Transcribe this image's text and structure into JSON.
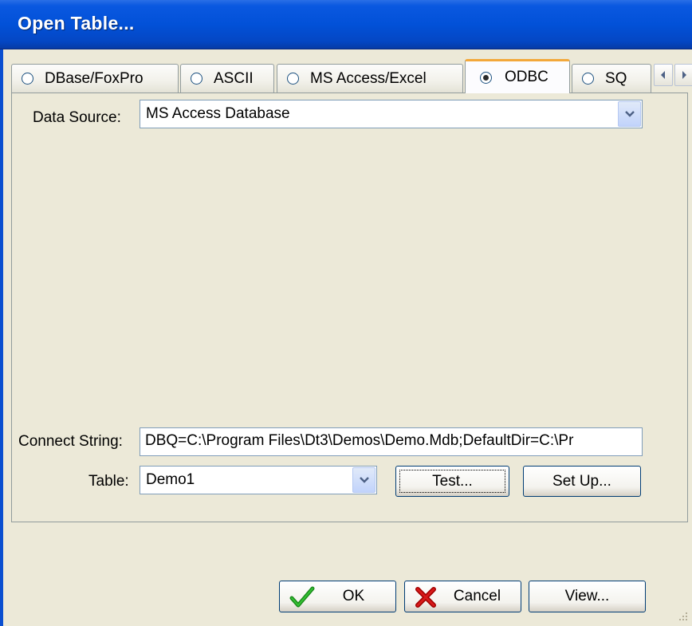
{
  "window": {
    "title": "Open Table..."
  },
  "tabs": [
    {
      "label": "DBase/FoxPro",
      "selected": false
    },
    {
      "label": "ASCII",
      "selected": false
    },
    {
      "label": "MS Access/Excel",
      "selected": false
    },
    {
      "label": "ODBC",
      "selected": true
    },
    {
      "label": "SQ",
      "selected": false
    }
  ],
  "tab_scroll": {
    "left_icon": "arrow-left-icon",
    "right_icon": "arrow-right-icon"
  },
  "form": {
    "data_source_label": "Data Source:",
    "data_source_value": "MS Access Database",
    "connect_string_label": "Connect String:",
    "connect_string_value": "DBQ=C:\\Program Files\\Dt3\\Demos\\Demo.Mdb;DefaultDir=C:\\Pr",
    "table_label": "Table:",
    "table_value": "Demo1",
    "test_button": "Test...",
    "setup_button": "Set Up..."
  },
  "buttons": {
    "ok": "OK",
    "cancel": "Cancel",
    "view": "View..."
  },
  "icons": {
    "ok": "checkmark-icon",
    "cancel": "x-cross-icon",
    "dropdown": "chevron-down-icon",
    "resize": "resize-grip-icon"
  }
}
